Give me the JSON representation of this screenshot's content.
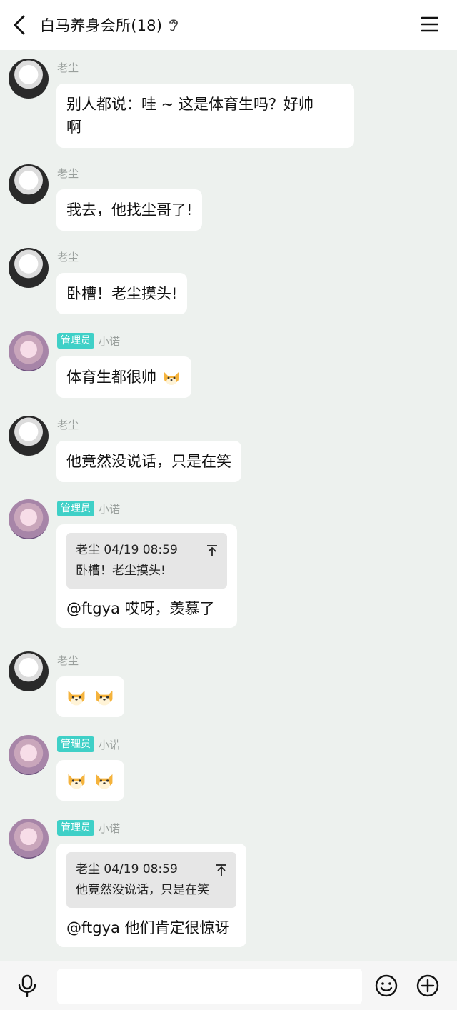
{
  "header": {
    "title": "白马养身会所(18)",
    "ear_icon": "ear-icon",
    "back_icon": "chevron-left-icon",
    "menu_icon": "hamburger-menu-icon"
  },
  "messages": [
    {
      "sender": "老尘",
      "role": "",
      "text": "别人都说：哇 ~ 这是体育生吗？好帅",
      "text2": "啊"
    },
    {
      "sender": "老尘",
      "role": "",
      "text": "我去，他找尘哥了!"
    },
    {
      "sender": "老尘",
      "role": "",
      "text": "卧槽！老尘摸头!"
    },
    {
      "sender": "小诺",
      "role": "管理员",
      "text": "体育生都很帅"
    },
    {
      "sender": "老尘",
      "role": "",
      "text": "他竟然没说话，只是在笑"
    },
    {
      "sender": "小诺",
      "role": "管理员",
      "quote_meta": "老尘 04/19 08:59",
      "quote_text": "卧槽！老尘摸头!",
      "text": "@ftgya 哎呀，羡慕了"
    },
    {
      "sender": "老尘",
      "role": "",
      "text": ""
    },
    {
      "sender": "小诺",
      "role": "管理员",
      "text": ""
    },
    {
      "sender": "小诺",
      "role": "管理员",
      "quote_meta": "老尘 04/19 08:59",
      "quote_text": "他竟然没说话，只是在笑",
      "text": "@ftgya 他们肯定很惊讶"
    }
  ],
  "input_bar": {
    "mic_icon": "microphone-icon",
    "emoji_icon": "smiley-icon",
    "plus_icon": "plus-circle-icon",
    "placeholder": ""
  },
  "colors": {
    "background": "#edf1ee",
    "badge": "#3fd0c7",
    "bubble": "#ffffff"
  }
}
